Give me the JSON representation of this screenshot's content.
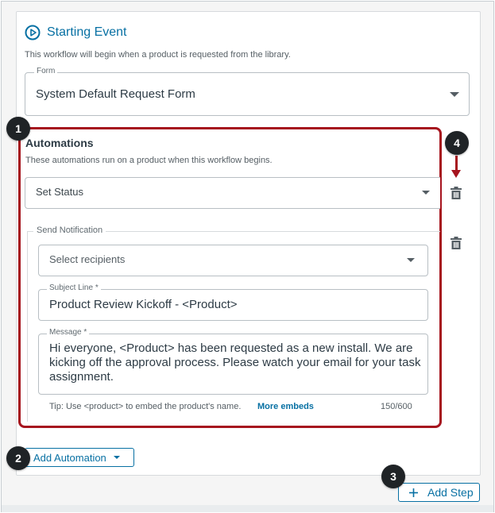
{
  "starting_event": {
    "title": "Starting Event",
    "description": "This workflow will begin when a product is requested from the library.",
    "form": {
      "legend": "Form",
      "value": "System Default Request Form"
    }
  },
  "automations": {
    "title": "Automations",
    "description": "These automations run on a product when this workflow begins.",
    "set_status": {
      "value": "Set Status"
    },
    "send_notification": {
      "legend": "Send Notification",
      "recipients_placeholder": "Select recipients",
      "subject_legend": "Subject Line *",
      "subject_value": "Product Review Kickoff - <Product>",
      "message_legend": "Message *",
      "message_value": "Hi everyone, <Product> has been requested as a new install. We are kicking off the approval process. Please watch your email for your task assignment.",
      "tip": "Tip: Use <product> to embed the product's name.",
      "tip_link": "More embeds",
      "counter": "150/600"
    }
  },
  "buttons": {
    "add_automation": "Add Automation",
    "add_step": "Add Step"
  },
  "badges": [
    "1",
    "2",
    "3",
    "4"
  ],
  "colors": {
    "accent": "#0770a3",
    "highlight": "#a6141e",
    "badge": "#1f2326"
  },
  "icons": {
    "start": "play-circle-icon",
    "dropdown": "caret-down-icon",
    "delete": "trash-icon",
    "add": "plus-icon"
  }
}
